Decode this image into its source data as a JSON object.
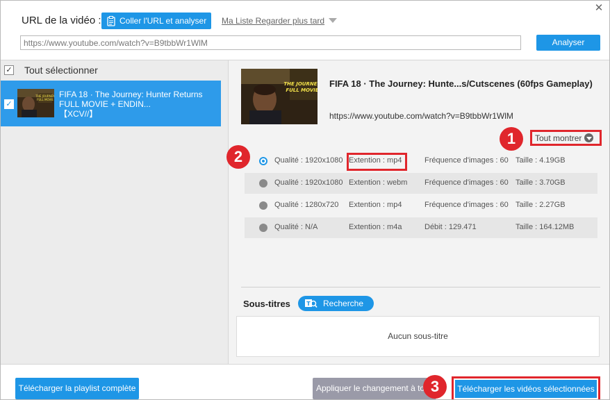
{
  "header": {
    "url_label": "URL de la vidéo :",
    "paste_button": "Coller l'URL et analyser",
    "watch_later": "Ma Liste Regarder plus tard",
    "url_value": "https://www.youtube.com/watch?v=B9tbbWr1WlM",
    "analyze_button": "Analyser",
    "close_glyph": "✕"
  },
  "sidebar": {
    "select_all_label": "Tout sélectionner",
    "items": [
      {
        "title": "FIFA 18 · The Journey: Hunter Returns FULL MOVIE + ENDIN...",
        "subtitle": "【XCV//】",
        "thumbnail_text": "THE JOURNEY FULL MOVIE",
        "checked": true
      }
    ]
  },
  "detail": {
    "title": "FIFA 18 · The Journey: Hunte...s/Cutscenes (60fps Gameplay)",
    "url": "https://www.youtube.com/watch?v=B9tbbWr1WlM",
    "thumbnail_text_1": "THE JOURNEY",
    "thumbnail_text_2": "FULL MOVIE",
    "show_all": "Tout montrer",
    "formats": [
      {
        "quality": "Qualité : 1920x1080",
        "extension": "Extention : mp4",
        "rate": "Fréquence d'images : 60",
        "size": "Taille : 4.19GB",
        "selected": true
      },
      {
        "quality": "Qualité : 1920x1080",
        "extension": "Extention : webm",
        "rate": "Fréquence d'images : 60",
        "size": "Taille : 3.70GB",
        "selected": false
      },
      {
        "quality": "Qualité : 1280x720",
        "extension": "Extention : mp4",
        "rate": "Fréquence d'images : 60",
        "size": "Taille : 2.27GB",
        "selected": false
      },
      {
        "quality": "Qualité : N/A",
        "extension": "Extention : m4a",
        "rate": "Débit : 129.471",
        "size": "Taille : 164.12MB",
        "selected": false
      }
    ],
    "subtitles_label": "Sous-titres",
    "search_button": "Recherche",
    "no_subtitles": "Aucun sous-titre"
  },
  "footer": {
    "playlist_button": "Télécharger la playlist complète",
    "apply_button": "Appliquer le changement à tout",
    "download_button": "Télécharger les vidéos sélectionnées"
  },
  "annotations": {
    "badge_1": "1",
    "badge_2": "2",
    "badge_3": "3"
  },
  "colors": {
    "accent": "#1e96e6",
    "highlight": "#e0262c",
    "selected_item": "#2e9bea"
  }
}
